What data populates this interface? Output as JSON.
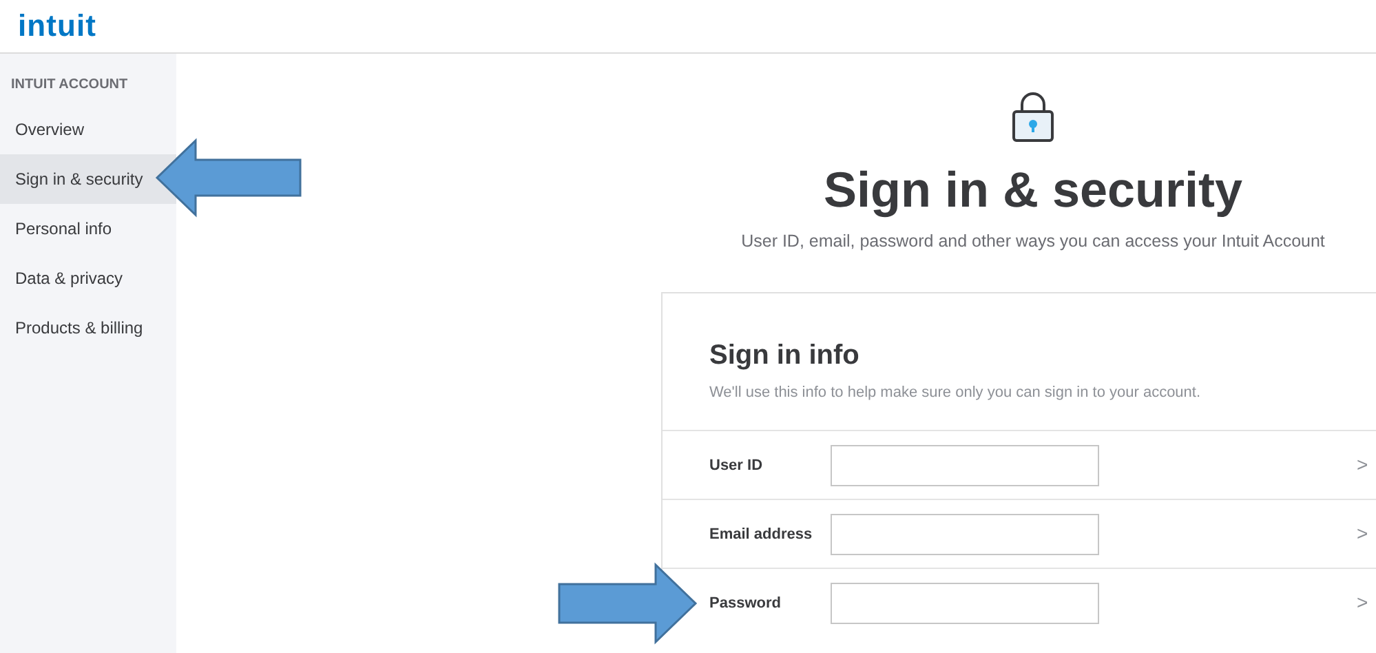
{
  "header": {
    "logo": "intuit"
  },
  "sidebar": {
    "heading": "INTUIT ACCOUNT",
    "items": [
      {
        "label": "Overview",
        "selected": false
      },
      {
        "label": "Sign in & security",
        "selected": true
      },
      {
        "label": "Personal info",
        "selected": false
      },
      {
        "label": "Data & privacy",
        "selected": false
      },
      {
        "label": "Products & billing",
        "selected": false
      }
    ]
  },
  "page": {
    "title": "Sign in & security",
    "subtitle": "User ID, email, password and other ways you can access your Intuit Account"
  },
  "card": {
    "title": "Sign in info",
    "description": "We'll use this info to help make sure only you can sign in to your account.",
    "rows": [
      {
        "label": "User ID",
        "chevron": ">"
      },
      {
        "label": "Email address",
        "chevron": ">"
      },
      {
        "label": "Password",
        "chevron": ">"
      }
    ]
  }
}
